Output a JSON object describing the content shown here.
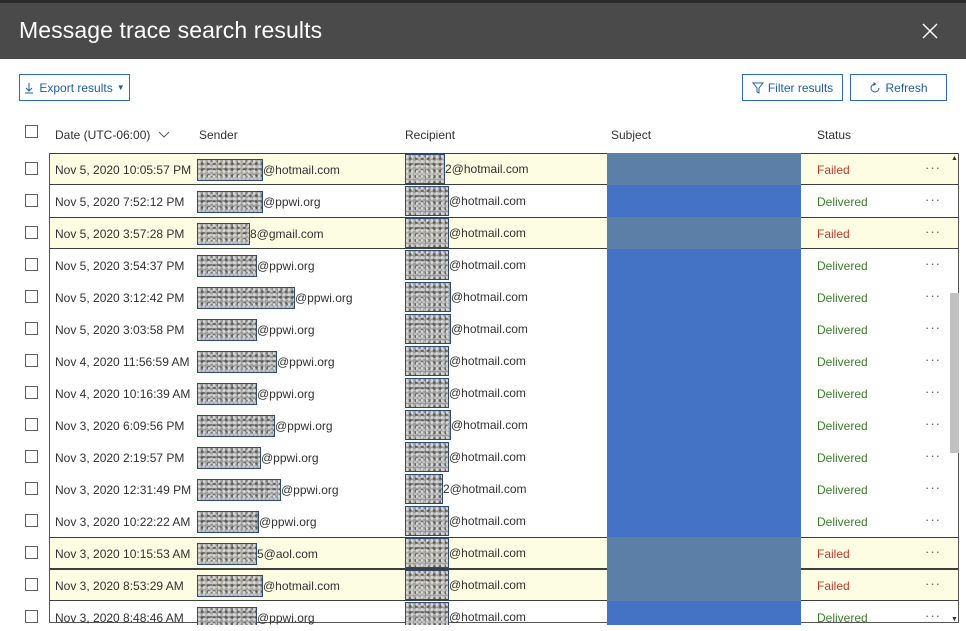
{
  "dialog": {
    "title": "Message trace search results"
  },
  "toolbar": {
    "export_label": "Export results",
    "filter_label": "Filter results",
    "refresh_label": "Refresh"
  },
  "columns": {
    "date": "Date (UTC-06:00)",
    "sender": "Sender",
    "recipient": "Recipient",
    "subject": "Subject",
    "status": "Status"
  },
  "colors": {
    "failed": "#c8372d",
    "delivered": "#3b7d23",
    "accent": "#2b6cb5",
    "failed_row": "#fdfde3"
  },
  "rows": [
    {
      "date": "Nov 5, 2020 10:05:57 PM",
      "sender_domain": "@hotmail.com",
      "recipient_domain": "2@hotmail.com",
      "status": "Failed"
    },
    {
      "date": "Nov 5, 2020 7:52:12 PM",
      "sender_domain": "@ppwi.org",
      "recipient_domain": "@hotmail.com",
      "status": "Delivered"
    },
    {
      "date": "Nov 5, 2020 3:57:28 PM",
      "sender_domain": "8@gmail.com",
      "recipient_domain": "@hotmail.com",
      "status": "Failed"
    },
    {
      "date": "Nov 5, 2020 3:54:37 PM",
      "sender_domain": "@ppwi.org",
      "recipient_domain": "@hotmail.com",
      "status": "Delivered"
    },
    {
      "date": "Nov 5, 2020 3:12:42 PM",
      "sender_domain": "@ppwi.org",
      "recipient_domain": "@hotmail.com",
      "status": "Delivered"
    },
    {
      "date": "Nov 5, 2020 3:03:58 PM",
      "sender_domain": "@ppwi.org",
      "recipient_domain": "@hotmail.com",
      "status": "Delivered"
    },
    {
      "date": "Nov 4, 2020 11:56:59 AM",
      "sender_domain": "@ppwi.org",
      "recipient_domain": "@hotmail.com",
      "status": "Delivered"
    },
    {
      "date": "Nov 4, 2020 10:16:39 AM",
      "sender_domain": "@ppwi.org",
      "recipient_domain": "@hotmail.com",
      "status": "Delivered"
    },
    {
      "date": "Nov 3, 2020 6:09:56 PM",
      "sender_domain": "@ppwi.org",
      "recipient_domain": "@hotmail.com",
      "status": "Delivered"
    },
    {
      "date": "Nov 3, 2020 2:19:57 PM",
      "sender_domain": "@ppwi.org",
      "recipient_domain": "@hotmail.com",
      "status": "Delivered"
    },
    {
      "date": "Nov 3, 2020 12:31:49 PM",
      "sender_domain": "@ppwi.org",
      "recipient_domain": "2@hotmail.com",
      "status": "Delivered"
    },
    {
      "date": "Nov 3, 2020 10:22:22 AM",
      "sender_domain": "@ppwi.org",
      "recipient_domain": "@hotmail.com",
      "status": "Delivered"
    },
    {
      "date": "Nov 3, 2020 10:15:53 AM",
      "sender_domain": "5@aol.com",
      "recipient_domain": "@hotmail.com",
      "status": "Failed"
    },
    {
      "date": "Nov 3, 2020 8:53:29 AM",
      "sender_domain": "@hotmail.com",
      "recipient_domain": "@hotmail.com",
      "status": "Failed"
    },
    {
      "date": "Nov 3, 2020 8:48:46 AM",
      "sender_domain": "@ppwi.org",
      "recipient_domain": "@hotmail.com",
      "status": "Delivered"
    }
  ],
  "row_actions_glyph": "···"
}
